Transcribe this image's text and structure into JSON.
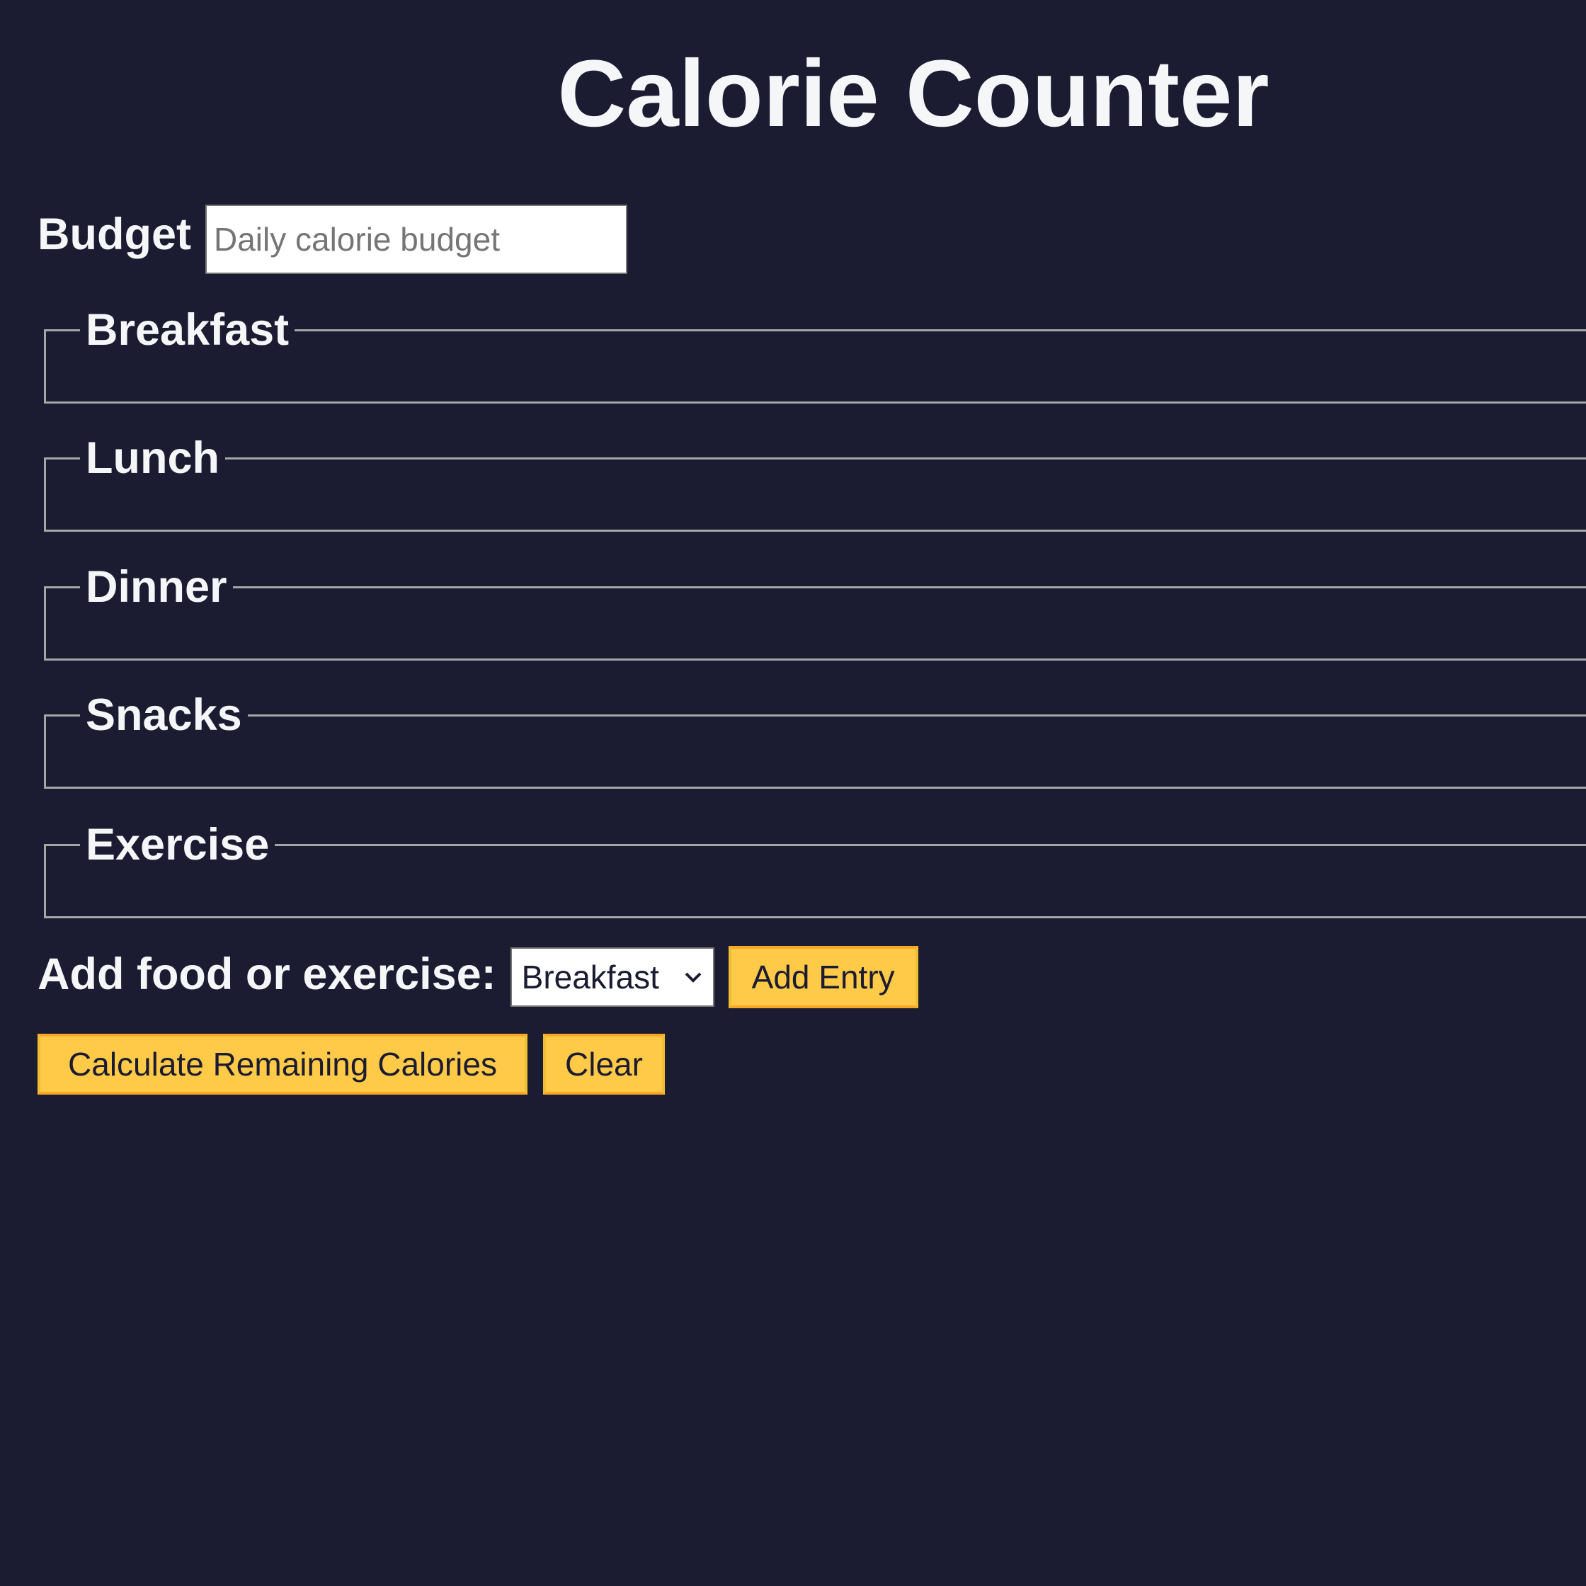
{
  "header": {
    "title": "Calorie Counter"
  },
  "budget": {
    "label": "Budget",
    "value": "",
    "placeholder": "Daily calorie budget"
  },
  "sections": [
    {
      "legend": "Breakfast"
    },
    {
      "legend": "Lunch"
    },
    {
      "legend": "Dinner"
    },
    {
      "legend": "Snacks"
    },
    {
      "legend": "Exercise"
    }
  ],
  "entry": {
    "label": "Add food or exercise:",
    "select_value": "Breakfast",
    "select_icon": "chevron-down-icon",
    "add_button": "Add Entry"
  },
  "actions": {
    "calculate_button": "Calculate Remaining Calories",
    "clear_button": "Clear"
  },
  "colors": {
    "background": "#1b1b32",
    "text": "#f5f6f7",
    "button": "#feca47",
    "button_border": "#f1be32",
    "fieldset_border": "#a6a6a6"
  }
}
